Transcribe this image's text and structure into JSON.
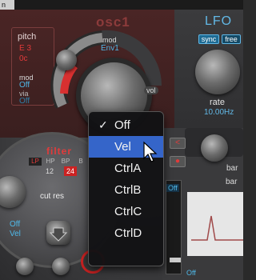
{
  "window": {
    "corner_label": "n"
  },
  "osc": {
    "title": "osc1",
    "pitch_label": "pitch",
    "pitch_note": "E 3",
    "pitch_offset": "0c",
    "mod_label": "mod",
    "mod_value": "Off",
    "via_label": "via",
    "via_value": "Off",
    "arc_mod_label": "mod",
    "arc_env_label": "Env1",
    "vol_label": "vol"
  },
  "lfo": {
    "title": "LFO",
    "sync_label": "sync",
    "free_label": "free",
    "rate_label": "rate",
    "rate_value": "10.00Hz"
  },
  "filter": {
    "title": "filter",
    "types": [
      "LP",
      "HP",
      "BP",
      "B"
    ],
    "slopes": [
      "12",
      "24"
    ],
    "cut_label": "cut",
    "res_label": "res",
    "mod_source": "Off",
    "mod_via": "Vel"
  },
  "right_panel": {
    "bar_label": "bar",
    "bar_label_2": "bar",
    "off_small": "Off",
    "off_bottom": "Off"
  },
  "menu": {
    "items": [
      {
        "label": "Off",
        "checked": true,
        "highlighted": false
      },
      {
        "label": "Vel",
        "checked": false,
        "highlighted": true
      },
      {
        "label": "CtrlA",
        "checked": false,
        "highlighted": false
      },
      {
        "label": "CtrlB",
        "checked": false,
        "highlighted": false
      },
      {
        "label": "CtrlC",
        "checked": false,
        "highlighted": false
      },
      {
        "label": "CtrlD",
        "checked": false,
        "highlighted": false
      }
    ],
    "check_glyph": "✓"
  },
  "colors": {
    "accent_blue": "#4fb8e8",
    "accent_red": "#e23a3a",
    "highlight": "#3565c9"
  }
}
